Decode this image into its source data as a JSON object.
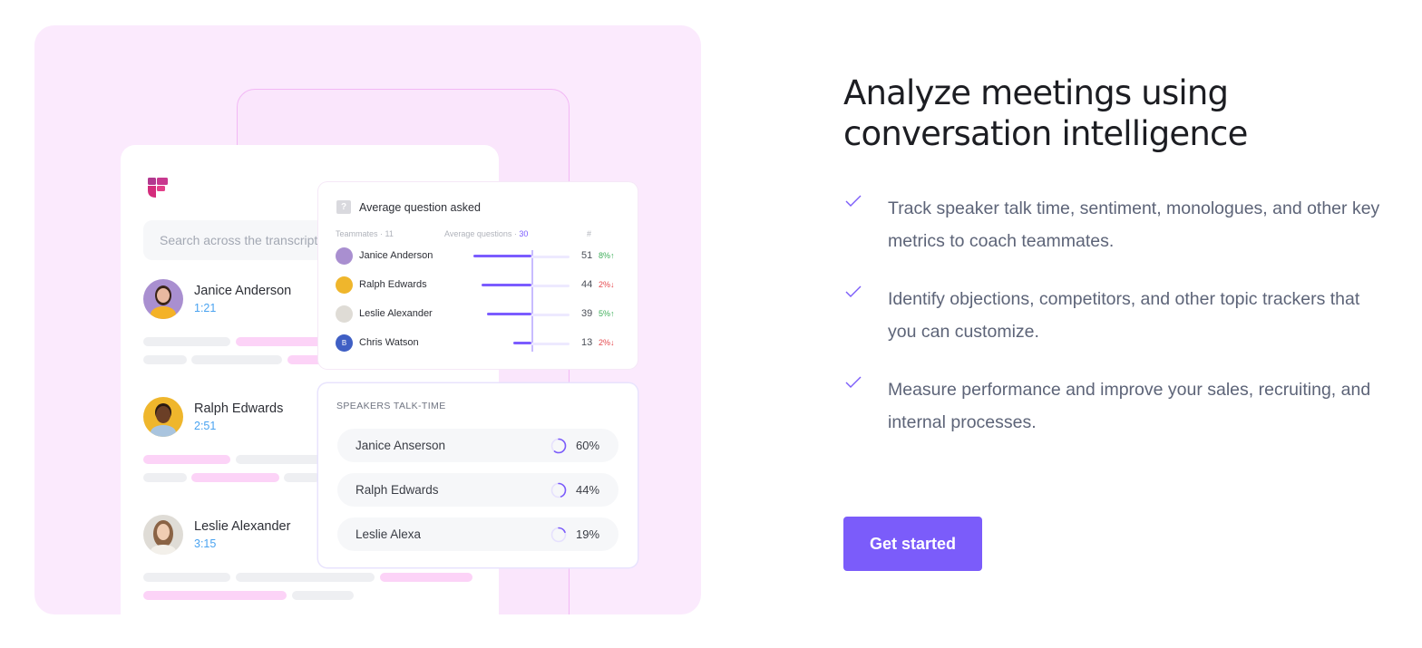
{
  "hero": {
    "title": "Analyze meetings using conversation intelligence",
    "features": [
      {
        "icon": "check-icon",
        "text": "Track speaker talk time, sentiment, monologues, and other key metrics to coach teammates."
      },
      {
        "icon": "check-icon",
        "text": "Identify objections, competitors, and other topic trackers that you can customize."
      },
      {
        "icon": "check-icon",
        "text": "Measure performance and improve your sales, recruiting, and internal processes."
      }
    ],
    "cta_label": "Get started"
  },
  "colors": {
    "accent": "#7b5cfa",
    "showcase_bg": "#fbeafd",
    "up": "#3fae5a",
    "down": "#e5484d",
    "time": "#4aa3f0"
  },
  "transcript": {
    "search_placeholder": "Search across the transcript",
    "speakers": [
      {
        "name": "Janice Anderson",
        "time": "1:21"
      },
      {
        "name": "Ralph Edwards",
        "time": "2:51"
      },
      {
        "name": "Leslie Alexander",
        "time": "3:15"
      }
    ]
  },
  "avg_questions": {
    "title": "Average question asked",
    "teammates_label": "Teammates · 11",
    "average_label": "Average questions · ",
    "average_value": "30",
    "count_header": "#",
    "rows": [
      {
        "name": "Janice Anderson",
        "count": 51,
        "count_text": "51",
        "change": "8%",
        "direction": "up",
        "initial": ""
      },
      {
        "name": "Ralph Edwards",
        "count": 44,
        "count_text": "44",
        "change": "2%",
        "direction": "down",
        "initial": ""
      },
      {
        "name": "Leslie Alexander",
        "count": 39,
        "count_text": "39",
        "change": "5%",
        "direction": "up",
        "initial": ""
      },
      {
        "name": "Chris Watson",
        "count": 13,
        "count_text": "13",
        "change": "2%",
        "direction": "down",
        "initial": "B"
      }
    ]
  },
  "talk_time": {
    "title": "SPEAKERS TALK-TIME",
    "rows": [
      {
        "name": "Janice Anserson",
        "percent": 60,
        "label": "60%"
      },
      {
        "name": "Ralph Edwards",
        "percent": 44,
        "label": "44%"
      },
      {
        "name": "Leslie Alexa",
        "percent": 19,
        "label": "19%"
      }
    ]
  }
}
